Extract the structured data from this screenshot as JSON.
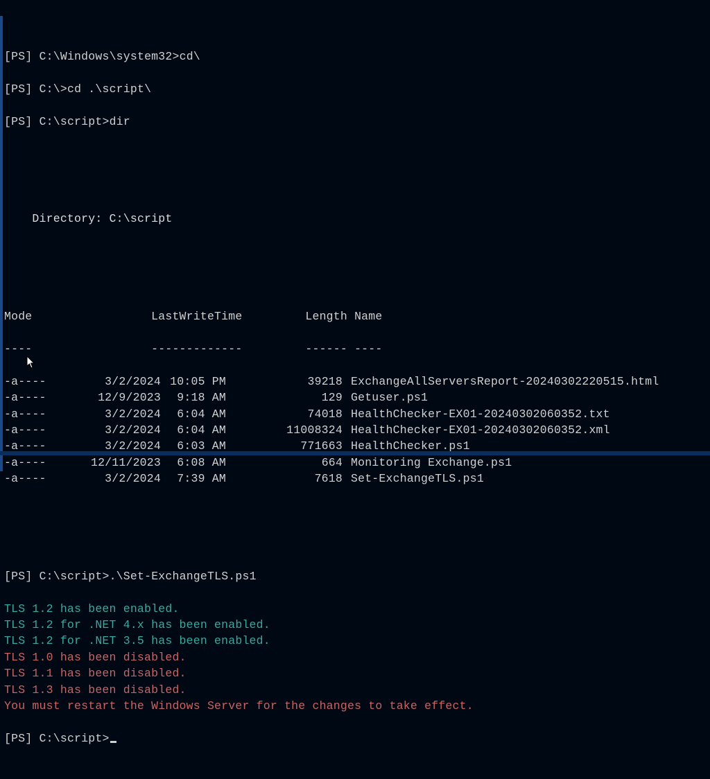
{
  "prompts": [
    {
      "ps": "PS",
      "path": "C:\\Windows\\system32",
      "cmd": "cd\\"
    },
    {
      "ps": "PS",
      "path": "C:\\",
      "cmd": "cd .\\script\\"
    },
    {
      "ps": "PS",
      "path": "C:\\script",
      "cmd": "dir"
    },
    {
      "ps": "PS",
      "path": "C:\\script",
      "cmd": ".\\Set-ExchangeTLS.ps1"
    },
    {
      "ps": "PS",
      "path": "C:\\script",
      "cmd": ""
    }
  ],
  "dir_header": "Directory: C:\\script",
  "columns": {
    "row": "Mode                 LastWriteTime         Length Name",
    "div": "----                 -------------         ------ ----"
  },
  "files": [
    {
      "mode": "-a----",
      "date": "3/2/2024",
      "time": "10:05 PM",
      "length": "39218",
      "name": "ExchangeAllServersReport-20240302220515.html"
    },
    {
      "mode": "-a----",
      "date": "12/9/2023",
      "time": "9:18 AM",
      "length": "129",
      "name": "Getuser.ps1"
    },
    {
      "mode": "-a----",
      "date": "3/2/2024",
      "time": "6:04 AM",
      "length": "74018",
      "name": "HealthChecker-EX01-20240302060352.txt"
    },
    {
      "mode": "-a----",
      "date": "3/2/2024",
      "time": "6:04 AM",
      "length": "11008324",
      "name": "HealthChecker-EX01-20240302060352.xml"
    },
    {
      "mode": "-a----",
      "date": "3/2/2024",
      "time": "6:03 AM",
      "length": "771663",
      "name": "HealthChecker.ps1"
    },
    {
      "mode": "-a----",
      "date": "12/11/2023",
      "time": "6:08 AM",
      "length": "664",
      "name": "Monitoring Exchange.ps1"
    },
    {
      "mode": "-a----",
      "date": "3/2/2024",
      "time": "7:39 AM",
      "length": "7618",
      "name": "Set-ExchangeTLS.ps1"
    }
  ],
  "tls_output": [
    {
      "text": "TLS 1.2 has been enabled.",
      "color": "teal"
    },
    {
      "text": "TLS 1.2 for .NET 4.x has been enabled.",
      "color": "teal"
    },
    {
      "text": "TLS 1.2 for .NET 3.5 has been enabled.",
      "color": "teal"
    },
    {
      "text": "TLS 1.0 has been disabled.",
      "color": "red"
    },
    {
      "text": "TLS 1.1 has been disabled.",
      "color": "red"
    },
    {
      "text": "TLS 1.3 has been disabled.",
      "color": "red"
    },
    {
      "text": "You must restart the Windows Server for the changes to take effect.",
      "color": "red"
    }
  ]
}
